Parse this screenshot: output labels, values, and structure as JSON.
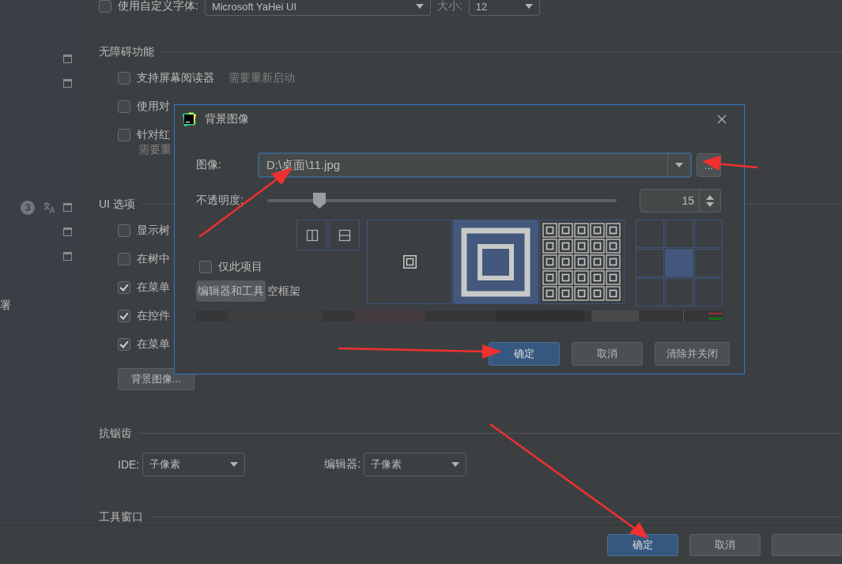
{
  "sidebar": {
    "badge": "3",
    "label": "署"
  },
  "font_row": {
    "checked": false,
    "label": "使用自定义字体:",
    "font": "Microsoft YaHei UI",
    "size_label": "大小:",
    "size": "12"
  },
  "accessibility": {
    "title": "无障碍功能",
    "options": [
      {
        "label": "支持屏幕阅读器",
        "checked": false,
        "note": "需要重新启动"
      },
      {
        "label": "使用对",
        "checked": false
      },
      {
        "label": "针对红",
        "checked": false,
        "note_below": "需要重"
      }
    ]
  },
  "ui_options": {
    "title": "UI 选项",
    "options": [
      {
        "label": "显示树",
        "checked": false
      },
      {
        "label": "在树中",
        "checked": false
      },
      {
        "label": "在菜单",
        "checked": true
      },
      {
        "label": "在控件",
        "checked": true
      },
      {
        "label": "在菜单",
        "checked": true
      }
    ],
    "button": "背景图像..."
  },
  "antialiasing": {
    "title": "抗锯齿",
    "fields": [
      {
        "label": "IDE:",
        "value": "子像素"
      },
      {
        "label": "编辑器:",
        "value": "子像素"
      }
    ]
  },
  "tool_windows": {
    "title": "工具窗口"
  },
  "footer": {
    "buttons": [
      {
        "label": "确定",
        "primary": true
      },
      {
        "label": "取消",
        "primary": false
      },
      {
        "primary": false
      }
    ]
  },
  "dialog": {
    "title": "背景图像",
    "image_label": "图像:",
    "image_path": "D:\\桌面\\11.jpg",
    "browse": "...",
    "opacity_label": "不透明度:",
    "opacity": {
      "level": 0.15,
      "value": "15"
    },
    "flip_buttons": [
      {
        "kind": "vertical"
      },
      {
        "kind": "horizontal"
      }
    ],
    "fill_modes": [
      {
        "kind": "center",
        "selected": false
      },
      {
        "kind": "scale",
        "selected": true
      },
      {
        "kind": "tile",
        "selected": false
      }
    ],
    "anchors": [
      {
        "selected": false
      },
      {
        "selected": false
      },
      {
        "selected": false
      },
      {
        "selected": false
      },
      {
        "selected": true
      },
      {
        "selected": false
      },
      {
        "selected": false
      },
      {
        "selected": false
      },
      {
        "selected": false
      }
    ],
    "this_project": {
      "label": "仅此项目",
      "checked": false
    },
    "targets": [
      {
        "label": "编辑器和工具",
        "selected": true
      },
      {
        "label": "空框架",
        "selected": false
      }
    ],
    "buttons": [
      {
        "label": "确定",
        "primary": true
      },
      {
        "label": "取消",
        "primary": false
      },
      {
        "label": "清除并关闭",
        "primary": false
      }
    ]
  }
}
